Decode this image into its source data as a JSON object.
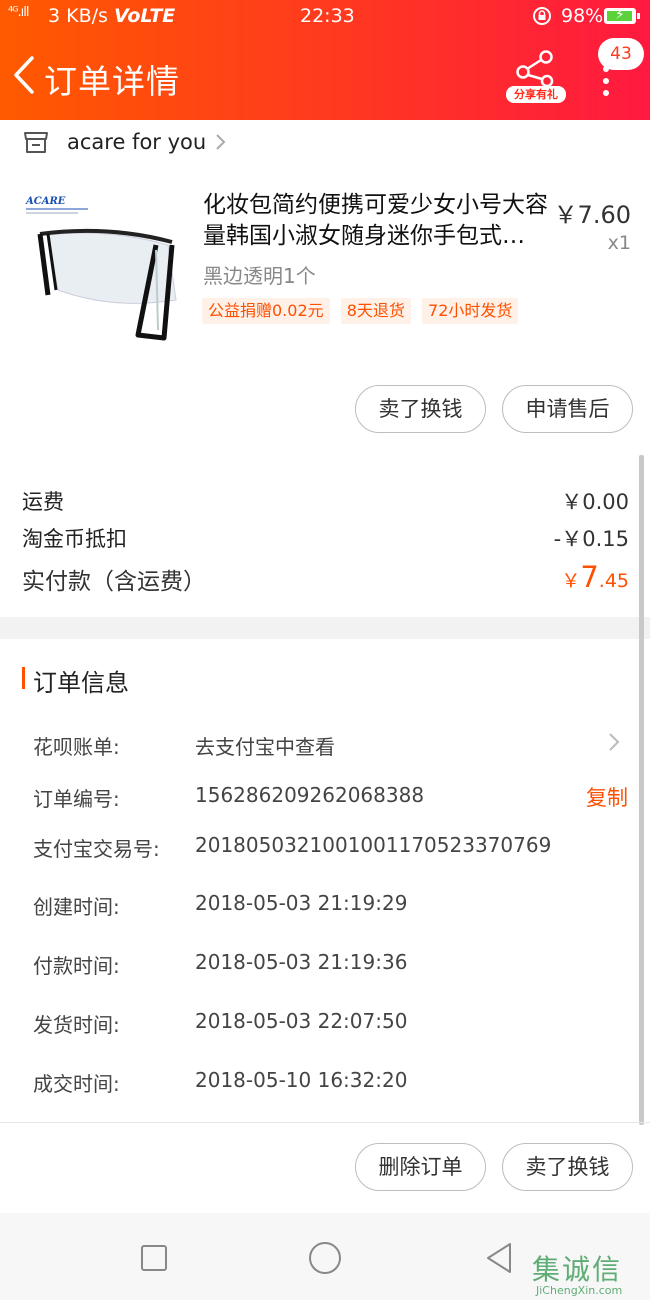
{
  "status_bar": {
    "signal": "⁴ᴳ.ıll",
    "speed": "3 KB/s",
    "network": "VoLTE",
    "time": "22:33",
    "battery_percent": "98%",
    "battery_level": 0.98
  },
  "header": {
    "title": "订单详情",
    "share_label": "分享有礼",
    "message_count": "43",
    "icons": [
      "back-arrow-icon",
      "share-icon",
      "more-vertical-icon"
    ]
  },
  "shop": {
    "name": "acare for you",
    "icons": [
      "store-icon",
      "chevron-right-icon"
    ]
  },
  "product": {
    "image_brand_text": "ACARE",
    "title": "化妆包简约便携可爱少女小号大容量韩国小淑女随身迷你手包式…",
    "price": "￥7.60",
    "quantity": "x1",
    "variant": "黑边透明1个",
    "tags": [
      "公益捐赠0.02元",
      "8天退货",
      "72小时发货"
    ]
  },
  "item_actions": {
    "sell_button": "卖了换钱",
    "after_sale_button": "申请售后"
  },
  "fees": {
    "shipping_label": "运费",
    "shipping_value": "￥0.00",
    "coins_label": "淘金币抵扣",
    "coins_value": "-￥0.15",
    "total_label": "实付款（含运费）",
    "total_symbol": "￥",
    "total_int": "7",
    "total_dec": ".45"
  },
  "order_info": {
    "section_title": "订单信息",
    "huabei_label": "花呗账单:",
    "huabei_value": "去支付宝中查看",
    "order_no_label": "订单编号:",
    "order_no_value": "1562862092620683​88",
    "copy_label": "复制",
    "alipay_label": "支付宝交易号:",
    "alipay_value": "2018050321001001170523370769",
    "created_label": "创建时间:",
    "created_value": "2018-05-03 21:19:29",
    "paid_label": "付款时间:",
    "paid_value": "2018-05-03 21:19:36",
    "shipped_label": "发货时间:",
    "shipped_value": "2018-05-03 22:07:50",
    "completed_label": "成交时间:",
    "completed_value": "2018-05-10 16:32:20"
  },
  "bottom_actions": {
    "delete_button": "删除订单",
    "sell_button": "卖了换钱"
  },
  "watermark": {
    "main": "集诚信",
    "sub": "JiChengXin.com"
  },
  "colors": {
    "accent": "#ff5000",
    "header_start": "#ff5a00",
    "header_end": "#ff1940"
  }
}
